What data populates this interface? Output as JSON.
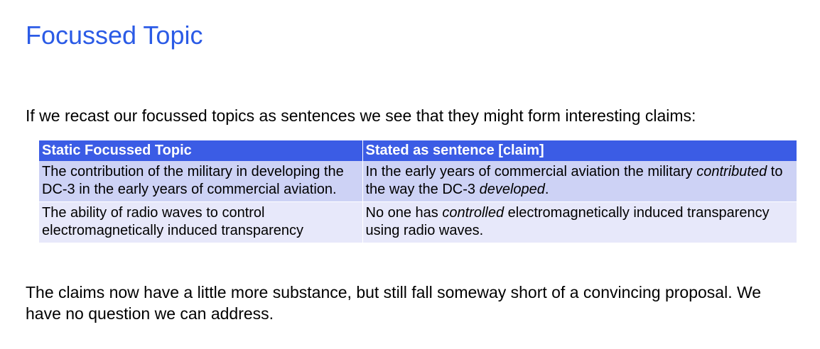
{
  "title": "Focussed Topic",
  "intro": "If we recast our focussed topics as sentences we see that they might form interesting claims:",
  "table": {
    "headers": [
      "Static Focussed Topic",
      "Stated as sentence [claim]"
    ],
    "rows": [
      {
        "topic": "The contribution of the military in developing the DC-3 in the early years of commercial aviation.",
        "claim": [
          {
            "text": "In the early years of commercial aviation the military ",
            "italic": false
          },
          {
            "text": "contributed",
            "italic": true
          },
          {
            "text": " to the way the DC-3 ",
            "italic": false
          },
          {
            "text": "developed",
            "italic": true
          },
          {
            "text": ".",
            "italic": false
          }
        ]
      },
      {
        "topic": "The ability of radio waves to control electromagnetically induced transparency",
        "claim": [
          {
            "text": "No one has ",
            "italic": false
          },
          {
            "text": "controlled",
            "italic": true
          },
          {
            "text": " electromagnetically induced transparency using radio waves.",
            "italic": false
          }
        ]
      }
    ],
    "colors": {
      "header_bg": "#3b5ce5",
      "row_a_bg": "#cdd2f5",
      "row_b_bg": "#e7e8fa"
    }
  },
  "conclusion": "The claims now have a little more substance, but still fall someway short of a convincing proposal. We have no question we can address.",
  "colors": {
    "title": "#2b5be6"
  }
}
